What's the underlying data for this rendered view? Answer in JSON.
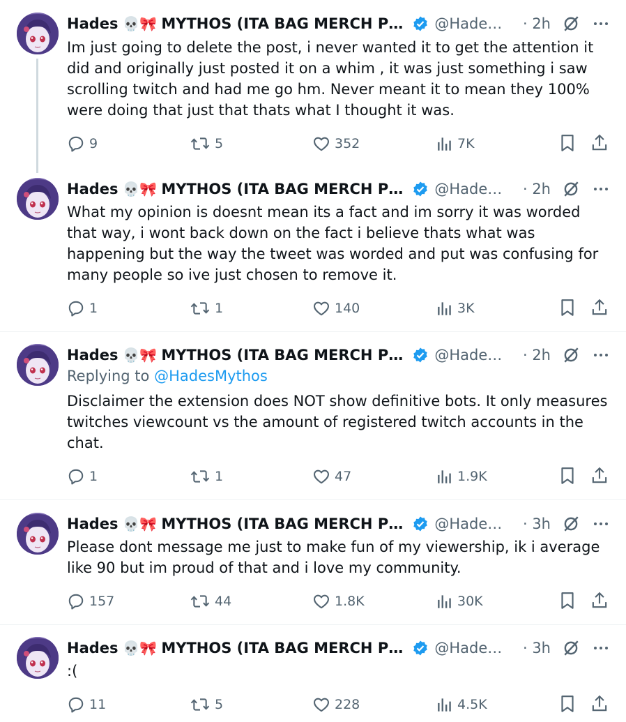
{
  "colors": {
    "text": "#0f1419",
    "muted": "#536471",
    "accent": "#1d9bf0",
    "divider": "#eff3f4"
  },
  "icons": [
    "reply-icon",
    "retweet-icon",
    "like-icon",
    "views-icon",
    "bookmark-icon",
    "share-icon",
    "verified-badge-icon",
    "grok-icon",
    "more-icon",
    "skull-emoji",
    "ribbon-emoji"
  ],
  "author": {
    "name": "Hades",
    "emoji": "💀🎀",
    "display_rest": "MYTHOS (ITA BAG MERCH PR...",
    "handle": "@Hades..."
  },
  "tweets": [
    {
      "time": "· 2h",
      "text": "Im just going to delete the post, i never wanted it to get the attention it did and originally just posted it on a whim , it was just something i saw scrolling twitch and had me go hm. Never meant it to mean they 100% were doing that just that thats what I thought it was.",
      "replies": "9",
      "retweets": "5",
      "likes": "352",
      "views": "7K"
    },
    {
      "time": "· 2h",
      "text": "What my opinion is doesnt mean its a fact and im sorry it was worded that way, i wont back down on the fact i believe thats what was happening but the way the tweet was worded and put was confusing for many people so ive just chosen to remove it.",
      "replies": "1",
      "retweets": "1",
      "likes": "140",
      "views": "3K"
    },
    {
      "time": "· 2h",
      "replying_prefix": "Replying to",
      "replying_handle": "@HadesMythos",
      "text": "Disclaimer the extension does NOT show definitive bots. It only measures twitches viewcount vs the amount of registered twitch accounts in the chat.",
      "replies": "1",
      "retweets": "1",
      "likes": "47",
      "views": "1.9K"
    },
    {
      "time": "· 3h",
      "text": "Please dont message me just to make fun of my viewership, ik i average like 90 but im proud of that and i love my community.",
      "replies": "157",
      "retweets": "44",
      "likes": "1.8K",
      "views": "30K"
    },
    {
      "time": "· 3h",
      "text": ":(",
      "replies": "11",
      "retweets": "5",
      "likes": "228",
      "views": "4.5K"
    }
  ]
}
